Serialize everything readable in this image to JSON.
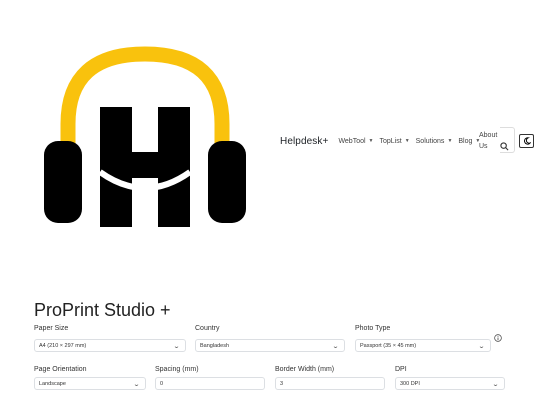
{
  "brand": {
    "name": "Helpdesk+"
  },
  "nav": {
    "items": [
      "WebTool",
      "TopList",
      "Solutions",
      "Blog"
    ],
    "about": "About Us"
  },
  "page": {
    "title": "ProPrint Studio +"
  },
  "form": {
    "paper_size": {
      "label": "Paper Size",
      "value": "A4 (210 × 297 mm)"
    },
    "country": {
      "label": "Country",
      "value": "Bangladesh"
    },
    "photo_type": {
      "label": "Photo Type",
      "value": "Passport (35 × 45 mm)"
    },
    "orientation": {
      "label": "Page Orientation",
      "value": "Landscape"
    },
    "spacing": {
      "label": "Spacing (mm)",
      "value": "0"
    },
    "border_width": {
      "label": "Border Width (mm)",
      "value": "3"
    },
    "dpi": {
      "label": "DPI",
      "value": "300 DPI"
    }
  },
  "icons": {
    "logo": "headphones-h-logo",
    "search": "search-icon",
    "theme": "moon-icon",
    "info": "info-icon"
  },
  "colors": {
    "logo_band": "#f9c20d",
    "logo_body": "#000000"
  }
}
